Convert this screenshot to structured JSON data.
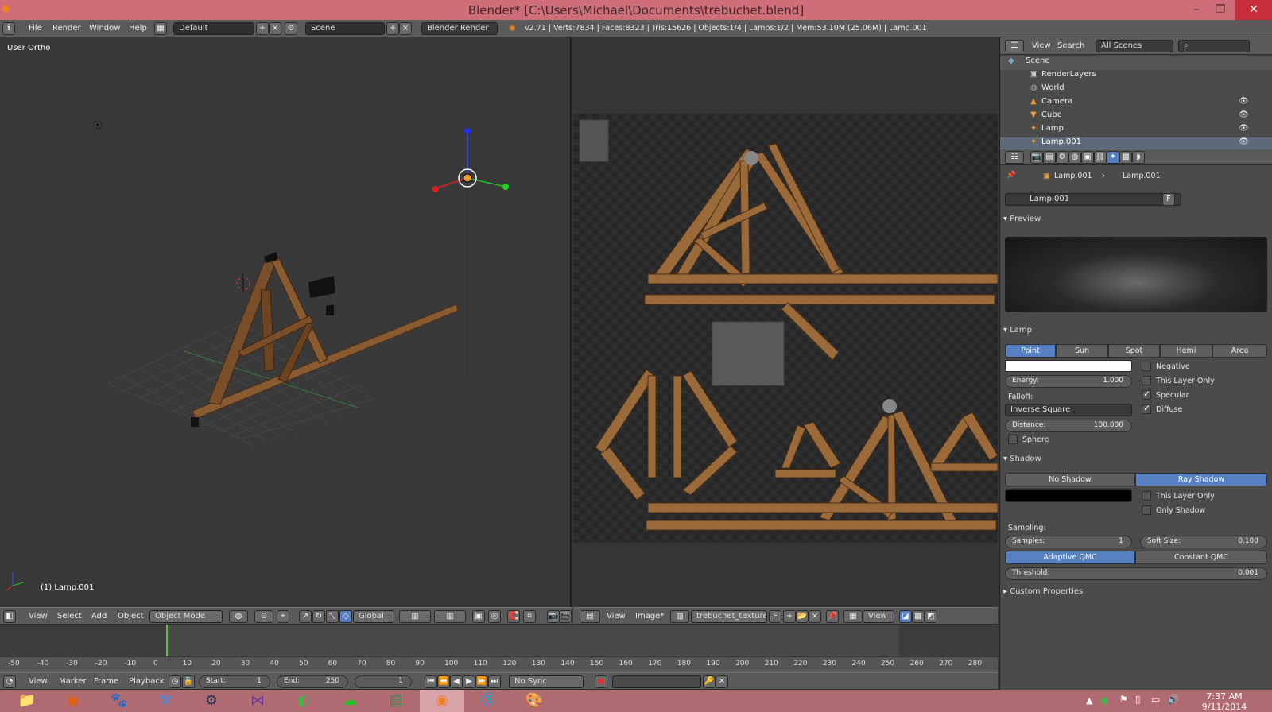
{
  "window": {
    "title": "Blender* [C:\\Users\\Michael\\Documents\\trebuchet.blend]",
    "minimize": "–",
    "maximize": "❐",
    "close": "✕"
  },
  "info_header": {
    "menus": [
      "File",
      "Render",
      "Window",
      "Help"
    ],
    "layout": "Default",
    "scene": "Scene",
    "engine": "Blender Render",
    "stats": "v2.71 | Verts:7834 | Faces:8323 | Tris:15626 | Objects:1/4 | Lamps:1/2 | Mem:53.10M (25.06M) | Lamp.001"
  },
  "view3d": {
    "label": "User Ortho",
    "active_object": "(1) Lamp.001",
    "header": {
      "menus": [
        "View",
        "Select",
        "Add",
        "Object"
      ],
      "mode": "Object Mode",
      "orientation": "Global"
    }
  },
  "image_editor": {
    "header": {
      "menus": [
        "View",
        "Image*"
      ],
      "image_name": "trebuchet_texture.p...",
      "fake_user": "F",
      "view": "View"
    }
  },
  "timeline": {
    "ticks": [
      "-50",
      "-40",
      "-30",
      "-20",
      "-10",
      "0",
      "10",
      "20",
      "30",
      "40",
      "50",
      "60",
      "70",
      "80",
      "90",
      "100",
      "110",
      "120",
      "130",
      "140",
      "150",
      "160",
      "170",
      "180",
      "190",
      "200",
      "210",
      "220",
      "230",
      "240",
      "250",
      "260",
      "270",
      "280"
    ],
    "header": {
      "menus": [
        "View",
        "Marker",
        "Frame",
        "Playback"
      ],
      "start_label": "Start:",
      "start": "1",
      "end_label": "End:",
      "end": "250",
      "current": "1",
      "sync": "No Sync"
    }
  },
  "outliner": {
    "header": {
      "menus": [
        "View",
        "Search"
      ],
      "filter": "All Scenes"
    },
    "items": [
      "Scene",
      "RenderLayers",
      "World",
      "Camera",
      "Cube",
      "Lamp",
      "Lamp.001"
    ]
  },
  "properties": {
    "breadcrumb": [
      "Lamp.001",
      "Lamp.001"
    ],
    "datablock": "Lamp.001",
    "fake_user": "F",
    "preview_title": "Preview",
    "lamp": {
      "title": "Lamp",
      "types": [
        "Point",
        "Sun",
        "Spot",
        "Hemi",
        "Area"
      ],
      "active_type": "Point",
      "energy_label": "Energy:",
      "energy": "1.000",
      "falloff_label": "Falloff:",
      "falloff": "Inverse Square",
      "distance_label": "Distance:",
      "distance": "100.000",
      "sphere": "Sphere",
      "negative": "Negative",
      "this_layer_only": "This Layer Only",
      "specular": "Specular",
      "diffuse": "Diffuse"
    },
    "shadow": {
      "title": "Shadow",
      "modes": [
        "No Shadow",
        "Ray Shadow"
      ],
      "this_layer_only": "This Layer Only",
      "only_shadow": "Only Shadow",
      "sampling_label": "Sampling:",
      "samples_label": "Samples:",
      "samples": "1",
      "soft_size_label": "Soft Size:",
      "soft_size": "0.100",
      "qmc": [
        "Adaptive QMC",
        "Constant QMC"
      ],
      "threshold_label": "Threshold:",
      "threshold": "0.001"
    },
    "custom_properties": "Custom Properties"
  },
  "taskbar": {
    "time": "7:37 AM",
    "date": "9/11/2014"
  }
}
